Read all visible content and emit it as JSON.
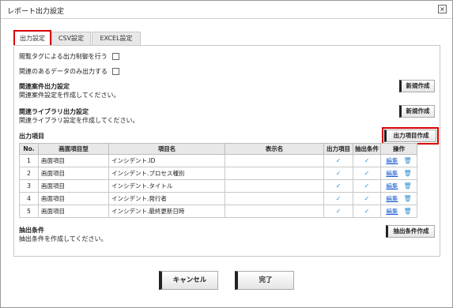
{
  "window": {
    "title": "レポート出力設定"
  },
  "tabs": [
    {
      "label": "出力設定"
    },
    {
      "label": "CSV設定"
    },
    {
      "label": "EXCEL設定"
    }
  ],
  "options": {
    "tag_control_label": "閲覧タグによる出力制御を行う",
    "tag_control_checked": false,
    "related_only_label": "関連のあるデータのみ出力する",
    "related_only_checked": false
  },
  "related_case": {
    "heading": "関連案件出力設定",
    "hint": "関連案件設定を作成してください。",
    "button": "新規作成"
  },
  "related_library": {
    "heading": "関連ライブラリ出力設定",
    "hint": "関連ライブラリ設定を作成してください。",
    "button": "新規作成"
  },
  "output_items": {
    "heading": "出力項目",
    "button": "出力項目作成",
    "columns": [
      "No.",
      "画面項目型",
      "項目名",
      "表示名",
      "出力項目",
      "抽出条件",
      "操作"
    ],
    "rows": [
      {
        "no": "1",
        "type": "画面項目",
        "name": "インシデント.ID",
        "display": "",
        "output": "✓",
        "filter": "✓",
        "edit": "編集",
        "delete_icon": "trash-icon"
      },
      {
        "no": "2",
        "type": "画面項目",
        "name": "インシデント.プロセス種別",
        "display": "",
        "output": "✓",
        "filter": "✓",
        "edit": "編集",
        "delete_icon": "trash-icon"
      },
      {
        "no": "3",
        "type": "画面項目",
        "name": "インシデント.タイトル",
        "display": "",
        "output": "✓",
        "filter": "✓",
        "edit": "編集",
        "delete_icon": "trash-icon"
      },
      {
        "no": "4",
        "type": "画面項目",
        "name": "インシデント.発行者",
        "display": "",
        "output": "✓",
        "filter": "✓",
        "edit": "編集",
        "delete_icon": "trash-icon"
      },
      {
        "no": "5",
        "type": "画面項目",
        "name": "インシデント.最終更新日時",
        "display": "",
        "output": "✓",
        "filter": "✓",
        "edit": "編集",
        "delete_icon": "trash-icon"
      }
    ]
  },
  "extract": {
    "heading": "抽出条件",
    "hint": "抽出条件を作成してください。",
    "button": "抽出条件作成"
  },
  "footer": {
    "cancel": "キャンセル",
    "done": "完了"
  },
  "colors": {
    "highlight": "#d80000",
    "check": "#2d8fd4",
    "link": "#1a5fd0"
  }
}
